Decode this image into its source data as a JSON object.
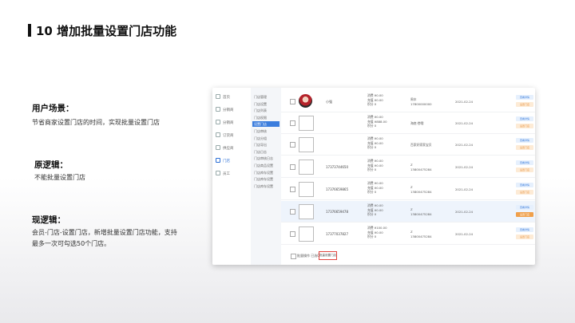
{
  "page": {
    "title": "10 增加批量设置门店功能",
    "sections": [
      {
        "heading": "用户场景：",
        "body": "节省商家设置门店的时间，实现批量设置门店"
      },
      {
        "heading": "原逻辑：",
        "body": "不能批量设置门店"
      },
      {
        "heading": "现逻辑：",
        "body_lines": [
          "会员-门店-设置门店，新增批量设置门店功能，支持",
          "最多一次可勾选50个门店。"
        ]
      }
    ]
  },
  "screenshot": {
    "nav_primary": [
      "首页",
      "分销商",
      "分销商",
      "订货商",
      "供应商",
      "门店",
      "员工"
    ],
    "nav_primary_active": 5,
    "nav_secondary": [
      "门店管理",
      "门店设置",
      "门店列表",
      "门店权限",
      "设置门店",
      "门店审核",
      "门店分组",
      "门店导出",
      "门店日志",
      "门店审核日志",
      "门店商品设置",
      "门店库存设置",
      "门店库存设置",
      "门店库存设置"
    ],
    "nav_secondary_active": 4,
    "rows": [
      {
        "avatar": true,
        "name": "小强",
        "bal": [
          "消费 ¥0.00",
          "充值 ¥0.00",
          "积分 0"
        ],
        "info": [
          "周丰",
          "17800000000"
        ],
        "date": "2021-02-24",
        "btn1": "查看详情",
        "btn2": "设置门店",
        "highlight": false,
        "btn2_strong": false
      },
      {
        "avatar": false,
        "name": "",
        "bal": [
          "消费 ¥0.00",
          "充值 ¥888.00",
          "积分 0"
        ],
        "info": [
          "海底·捞哦"
        ],
        "date": "2021-02-24",
        "btn1": "查看详情",
        "btn2": "设置门店",
        "highlight": false,
        "btn2_strong": false
      },
      {
        "avatar": false,
        "name": "",
        "bal": [
          "消费 ¥0.00",
          "充值 ¥0.00",
          "积分 0"
        ],
        "info": [
          "百家好家家宝贝"
        ],
        "date": "2021-02-24",
        "btn1": "查看详情",
        "btn2": "设置门店",
        "highlight": false,
        "btn2_strong": false
      },
      {
        "avatar": false,
        "name": "17373744650",
        "bal": [
          "消费 ¥0.00",
          "充值 ¥0.00",
          "积分 0"
        ],
        "info": [
          "Z",
          "13800475284"
        ],
        "date": "2021-02-24",
        "btn1": "查看详情",
        "btn2": "设置门店",
        "highlight": false,
        "btn2_strong": false
      },
      {
        "avatar": false,
        "name": "17376659865",
        "bal": [
          "消费 ¥0.00",
          "充值 ¥0.00",
          "积分 0"
        ],
        "info": [
          "Z",
          "13800475284"
        ],
        "date": "2021-02-24",
        "btn1": "查看详情",
        "btn2": "设置门店",
        "highlight": false,
        "btn2_strong": false
      },
      {
        "avatar": false,
        "name": "17376659478",
        "bal": [
          "消费 ¥0.00",
          "充值 ¥0.00",
          "积分 0"
        ],
        "info": [
          "Z",
          "13800475284"
        ],
        "date": "2021-02-24",
        "btn1": "查看详情",
        "btn2": "设置门店",
        "highlight": true,
        "btn2_strong": true
      },
      {
        "avatar": false,
        "name": "17377037827",
        "bal": [
          "消费 ¥100.00",
          "充值 ¥0.00",
          "积分 0"
        ],
        "info": [
          "Z",
          "13800475284"
        ],
        "date": "2021-02-24",
        "btn1": "查看详情",
        "btn2": "设置门店",
        "highlight": false,
        "btn2_strong": false
      }
    ],
    "footer": {
      "select_all": "批量操作",
      "selected": "已选0",
      "batch_button": "批量设置门店"
    }
  }
}
